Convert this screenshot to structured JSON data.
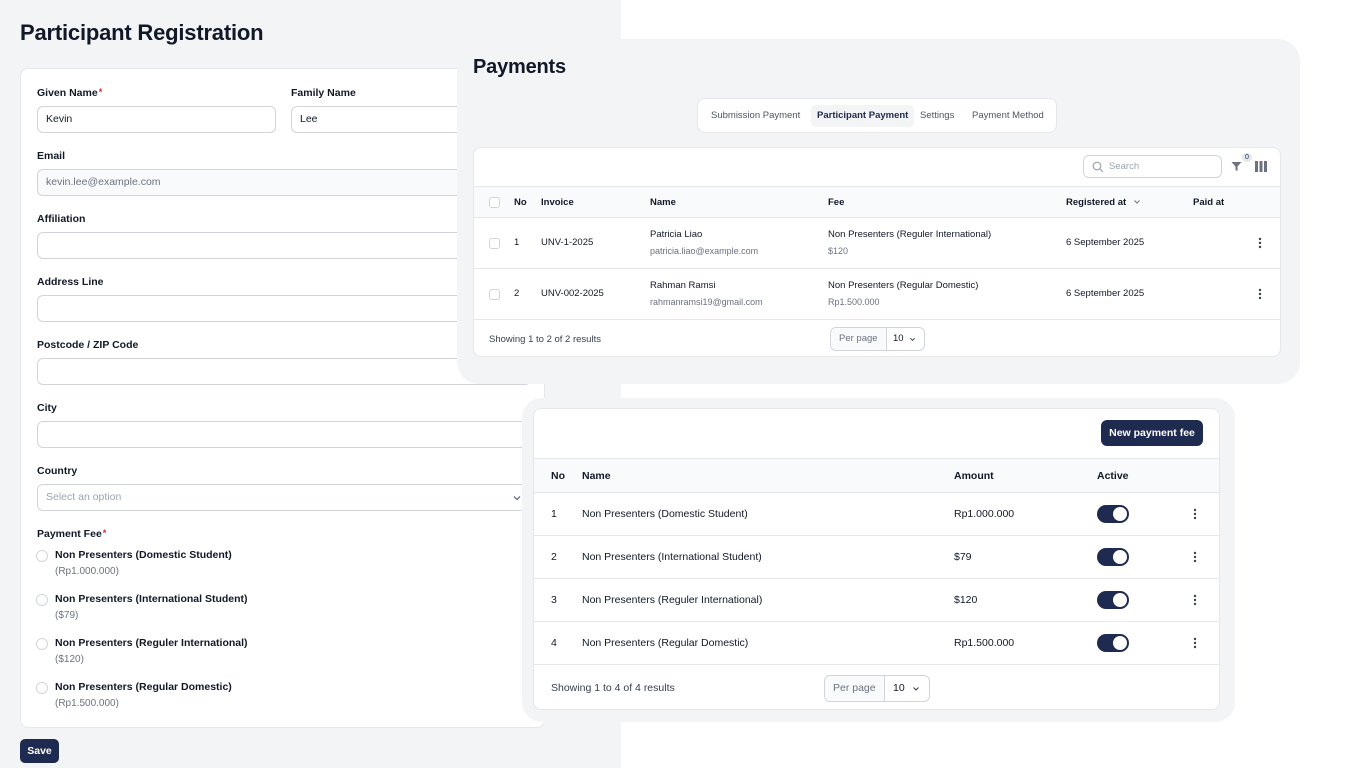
{
  "registration": {
    "title": "Participant Registration",
    "given_name_label": "Given Name",
    "required_mark": "*",
    "given_name_value": "Kevin",
    "family_name_label": "Family Name",
    "family_name_value": "Lee",
    "email_label": "Email",
    "email_value": "kevin.lee@example.com",
    "affiliation_label": "Affiliation",
    "affiliation_value": "",
    "address_label": "Address Line",
    "address_value": "",
    "postcode_label": "Postcode / ZIP Code",
    "postcode_value": "",
    "city_label": "City",
    "city_value": "",
    "country_label": "Country",
    "country_placeholder": "Select an option",
    "payment_fee_label": "Payment Fee",
    "fee_options": [
      {
        "name": "Non Presenters (Domestic Student)",
        "price": "(Rp1.000.000)"
      },
      {
        "name": "Non Presenters (International Student)",
        "price": "($79)"
      },
      {
        "name": "Non Presenters (Reguler International)",
        "price": "($120)"
      },
      {
        "name": "Non Presenters (Regular Domestic)",
        "price": "(Rp1.500.000)"
      }
    ],
    "save_label": "Save"
  },
  "payments": {
    "title": "Payments",
    "tabs": [
      {
        "label": "Submission Payment",
        "active": false
      },
      {
        "label": "Participant Payment",
        "active": true
      },
      {
        "label": "Settings",
        "active": false
      },
      {
        "label": "Payment Method",
        "active": false
      }
    ],
    "search_placeholder": "Search",
    "filter_count": "0",
    "columns": {
      "no": "No",
      "invoice": "Invoice",
      "name": "Name",
      "fee": "Fee",
      "registered_at": "Registered at",
      "paid_at": "Paid at"
    },
    "rows": [
      {
        "no": "1",
        "invoice": "UNV-1-2025",
        "name": "Patricia Liao",
        "email": "patricia.liao@example.com",
        "fee": "Non Presenters (Reguler International)",
        "amount": "$120",
        "registered_at": "6 September 2025",
        "paid_at": ""
      },
      {
        "no": "2",
        "invoice": "UNV-002-2025",
        "name": "Rahman Ramsi",
        "email": "rahmanramsi19@gmail.com",
        "fee": "Non Presenters (Regular Domestic)",
        "amount": "Rp1.500.000",
        "registered_at": "6 September 2025",
        "paid_at": ""
      }
    ],
    "showing": "Showing 1 to 2 of 2 results",
    "per_page_label": "Per page",
    "per_page_value": "10"
  },
  "payment_fees": {
    "new_button": "New payment fee",
    "columns": {
      "no": "No",
      "name": "Name",
      "amount": "Amount",
      "active": "Active"
    },
    "rows": [
      {
        "no": "1",
        "name": "Non Presenters (Domestic Student)",
        "amount": "Rp1.000.000",
        "active": true
      },
      {
        "no": "2",
        "name": "Non Presenters (International Student)",
        "amount": "$79",
        "active": true
      },
      {
        "no": "3",
        "name": "Non Presenters (Reguler International)",
        "amount": "$120",
        "active": true
      },
      {
        "no": "4",
        "name": "Non Presenters (Regular Domestic)",
        "amount": "Rp1.500.000",
        "active": true
      }
    ],
    "showing": "Showing 1 to 4 of 4 results",
    "per_page_label": "Per page",
    "per_page_value": "10"
  },
  "colors": {
    "primary": "#1e2a4f",
    "required": "#dc2626",
    "panel_bg": "#f3f4f6"
  }
}
